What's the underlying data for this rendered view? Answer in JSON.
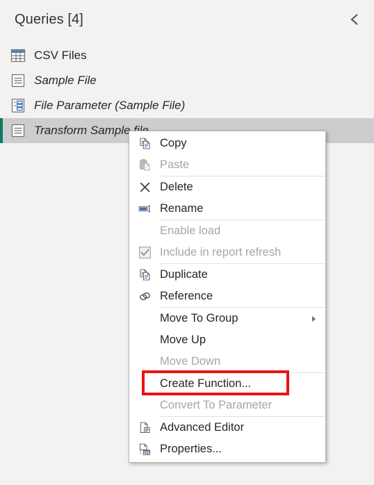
{
  "pane": {
    "title": "Queries [4]",
    "collapse_icon": "chevron-left-icon",
    "accent_color": "#117865",
    "selected_row_color": "#cdcdcd",
    "background_color": "#f3f2f1"
  },
  "queries": [
    {
      "label": "CSV Files",
      "icon": "table-icon",
      "italic": false,
      "selected": false
    },
    {
      "label": "Sample File",
      "icon": "query-icon",
      "italic": true,
      "selected": false
    },
    {
      "label": "File Parameter (Sample File)",
      "icon": "parameter-icon",
      "italic": true,
      "selected": false
    },
    {
      "label": "Transform Sample file",
      "icon": "query-icon",
      "italic": true,
      "selected": true
    }
  ],
  "context_menu": {
    "highlight_color": "#ee1111",
    "highlighted_item": "Create Function...",
    "items": [
      {
        "label": "Copy",
        "icon": "copy-icon",
        "disabled": false,
        "separator_after": false,
        "submenu": false,
        "highlighted": false
      },
      {
        "label": "Paste",
        "icon": "paste-icon",
        "disabled": true,
        "separator_after": true,
        "submenu": false,
        "highlighted": false
      },
      {
        "label": "Delete",
        "icon": "delete-x-icon",
        "disabled": false,
        "separator_after": false,
        "submenu": false,
        "highlighted": false
      },
      {
        "label": "Rename",
        "icon": "rename-icon",
        "disabled": false,
        "separator_after": true,
        "submenu": false,
        "highlighted": false
      },
      {
        "label": "Enable load",
        "icon": "none",
        "disabled": true,
        "separator_after": false,
        "submenu": false,
        "highlighted": false
      },
      {
        "label": "Include in report refresh",
        "icon": "checkbox-checked-icon",
        "disabled": true,
        "separator_after": true,
        "submenu": false,
        "highlighted": false
      },
      {
        "label": "Duplicate",
        "icon": "duplicate-icon",
        "disabled": false,
        "separator_after": false,
        "submenu": false,
        "highlighted": false
      },
      {
        "label": "Reference",
        "icon": "reference-link-icon",
        "disabled": false,
        "separator_after": true,
        "submenu": false,
        "highlighted": false
      },
      {
        "label": "Move To Group",
        "icon": "none",
        "disabled": false,
        "separator_after": false,
        "submenu": true,
        "highlighted": false
      },
      {
        "label": "Move Up",
        "icon": "none",
        "disabled": false,
        "separator_after": false,
        "submenu": false,
        "highlighted": false
      },
      {
        "label": "Move Down",
        "icon": "none",
        "disabled": true,
        "separator_after": true,
        "submenu": false,
        "highlighted": false
      },
      {
        "label": "Create Function...",
        "icon": "none",
        "disabled": false,
        "separator_after": false,
        "submenu": false,
        "highlighted": true
      },
      {
        "label": "Convert To Parameter",
        "icon": "none",
        "disabled": true,
        "separator_after": true,
        "submenu": false,
        "highlighted": false
      },
      {
        "label": "Advanced Editor",
        "icon": "advanced-editor-icon",
        "disabled": false,
        "separator_after": false,
        "submenu": false,
        "highlighted": false
      },
      {
        "label": "Properties...",
        "icon": "properties-icon",
        "disabled": false,
        "separator_after": false,
        "submenu": false,
        "highlighted": false
      }
    ]
  }
}
